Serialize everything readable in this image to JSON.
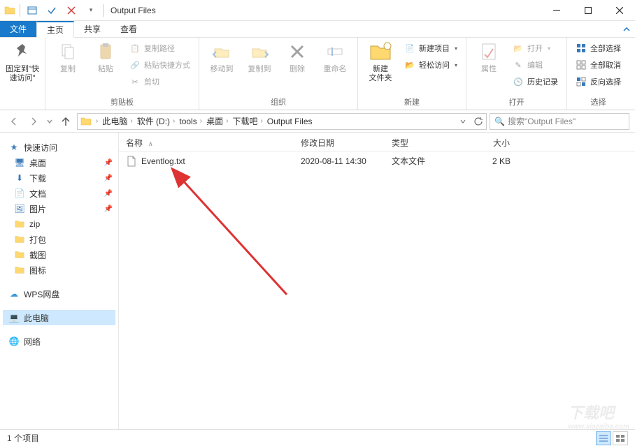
{
  "window": {
    "title": "Output Files"
  },
  "tabs": {
    "file": "文件",
    "home": "主页",
    "share": "共享",
    "view": "查看"
  },
  "ribbon": {
    "pin": {
      "label": "固定到\"快速访问\""
    },
    "copy": "复制",
    "paste": "粘贴",
    "copy_path": "复制路径",
    "paste_shortcut": "粘贴快捷方式",
    "cut": "剪切",
    "clipboard_group": "剪贴板",
    "move_to": "移动到",
    "copy_to": "复制到",
    "delete": "删除",
    "rename": "重命名",
    "organize_group": "组织",
    "new_folder": "新建\n文件夹",
    "new_item": "新建项目",
    "easy_access": "轻松访问",
    "new_group": "新建",
    "properties": "属性",
    "open": "打开",
    "edit": "编辑",
    "history": "历史记录",
    "open_group": "打开",
    "select_all": "全部选择",
    "select_none": "全部取消",
    "invert_sel": "反向选择",
    "select_group": "选择"
  },
  "breadcrumbs": [
    "此电脑",
    "软件 (D:)",
    "tools",
    "桌面",
    "下载吧",
    "Output Files"
  ],
  "search": {
    "placeholder": "搜索\"Output Files\""
  },
  "columns": {
    "name": "名称",
    "date": "修改日期",
    "type": "类型",
    "size": "大小"
  },
  "file": {
    "name": "Eventlog.txt",
    "date": "2020-08-11 14:30",
    "type": "文本文件",
    "size": "2 KB"
  },
  "nav": {
    "quick_access": "快速访问",
    "desktop": "桌面",
    "downloads": "下载",
    "documents": "文档",
    "pictures": "图片",
    "zip": "zip",
    "package": "打包",
    "screenshot": "截图",
    "icon": "图标",
    "wps": "WPS网盘",
    "this_pc": "此电脑",
    "network": "网络"
  },
  "status": {
    "count": "1 个项目"
  },
  "watermark": {
    "big": "下载吧",
    "small": "www.xiazaiba.com"
  }
}
